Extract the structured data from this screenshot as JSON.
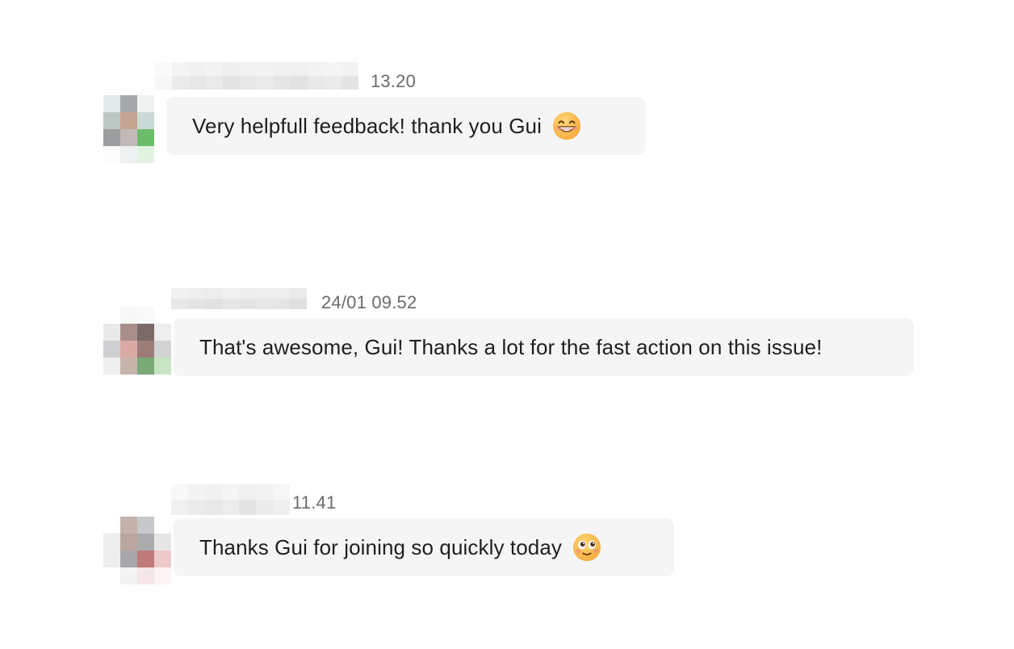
{
  "messages": [
    {
      "timestamp": "13.20",
      "text": "Very helpfull feedback! thank you Gui",
      "emoji": "grinning-face-emoji"
    },
    {
      "timestamp": "24/01 09.52",
      "text": "That's awesome, Gui! Thanks a lot for the fast action on this issue!",
      "emoji": ""
    },
    {
      "timestamp": "11.41",
      "text": "Thanks Gui for joining so quickly today",
      "emoji": "pleading-face-emoji"
    }
  ],
  "colors": {
    "bubble": "#f5f5f5",
    "text": "#1f1f1f",
    "timestamp": "#6b6b6b"
  }
}
